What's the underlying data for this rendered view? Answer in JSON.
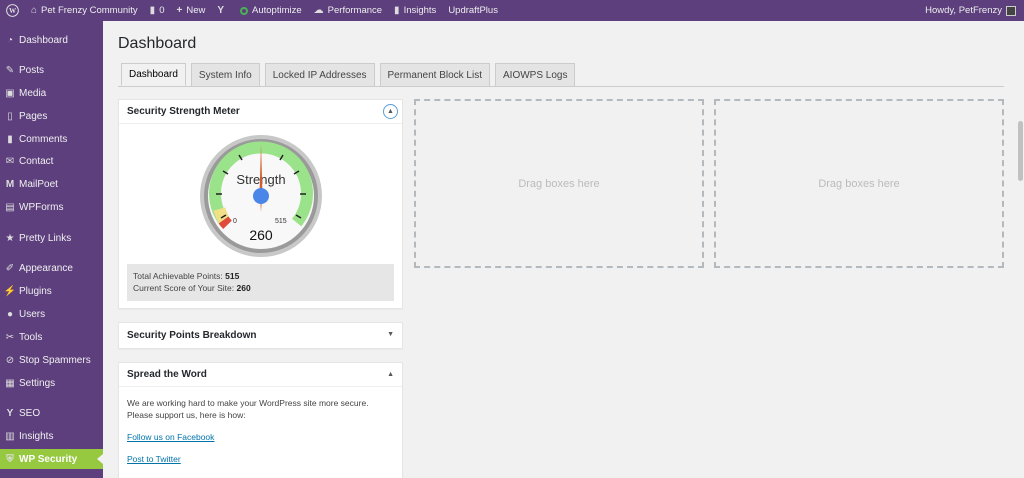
{
  "admin_bar": {
    "site_name": "Pet Frenzy Community",
    "comments_count": "0",
    "new_label": "New",
    "yoast_label": "",
    "autoptimize_label": "Autoptimize",
    "performance_label": "Performance",
    "insights_label": "Insights",
    "updraft_label": "UpdraftPlus",
    "howdy_label": "Howdy, PetFrenzy"
  },
  "sidebar": {
    "items": [
      {
        "label": "Dashboard",
        "icon": "dashboard-icon"
      },
      {
        "label": "Posts",
        "icon": "pin-icon"
      },
      {
        "label": "Media",
        "icon": "media-icon"
      },
      {
        "label": "Pages",
        "icon": "pages-icon"
      },
      {
        "label": "Comments",
        "icon": "comment-icon"
      },
      {
        "label": "Contact",
        "icon": "envelope-icon"
      },
      {
        "label": "MailPoet",
        "icon": "mailpoet-icon"
      },
      {
        "label": "WPForms",
        "icon": "form-icon"
      },
      {
        "label": "Pretty Links",
        "icon": "link-icon"
      },
      {
        "label": "Appearance",
        "icon": "brush-icon"
      },
      {
        "label": "Plugins",
        "icon": "plug-icon"
      },
      {
        "label": "Users",
        "icon": "user-icon"
      },
      {
        "label": "Tools",
        "icon": "wrench-icon"
      },
      {
        "label": "Stop Spammers",
        "icon": "stop-icon"
      },
      {
        "label": "Settings",
        "icon": "settings-icon"
      },
      {
        "label": "SEO",
        "icon": "seo-icon"
      },
      {
        "label": "Insights",
        "icon": "chart-icon"
      },
      {
        "label": "WP Security",
        "icon": "shield-icon"
      }
    ]
  },
  "main": {
    "title": "Dashboard",
    "tabs": [
      {
        "label": "Dashboard"
      },
      {
        "label": "System Info"
      },
      {
        "label": "Locked IP Addresses"
      },
      {
        "label": "Permanent Block List"
      },
      {
        "label": "AIOWPS Logs"
      }
    ],
    "meter": {
      "title": "Security Strength Meter",
      "gauge_label": "Strength",
      "min_label": "0",
      "max_label": "515",
      "value": "260",
      "value_fraction": 0.505,
      "total_label": "Total Achievable Points:",
      "total_value": "515",
      "current_label": "Current Score of Your Site:",
      "current_value": "260"
    },
    "breakdown": {
      "title": "Security Points Breakdown"
    },
    "spread": {
      "title": "Spread the Word",
      "text": "We are working hard to make your WordPress site more secure. Please support us, here is how:",
      "link1": "Follow us on Facebook",
      "link2": "Post to Twitter"
    },
    "drop_text_1": "Drag boxes here",
    "drop_text_2": "Drag boxes here"
  },
  "colors": {
    "admin_purple": "#5d3f7d",
    "active_green": "#96c840",
    "link_blue": "#0073aa"
  }
}
